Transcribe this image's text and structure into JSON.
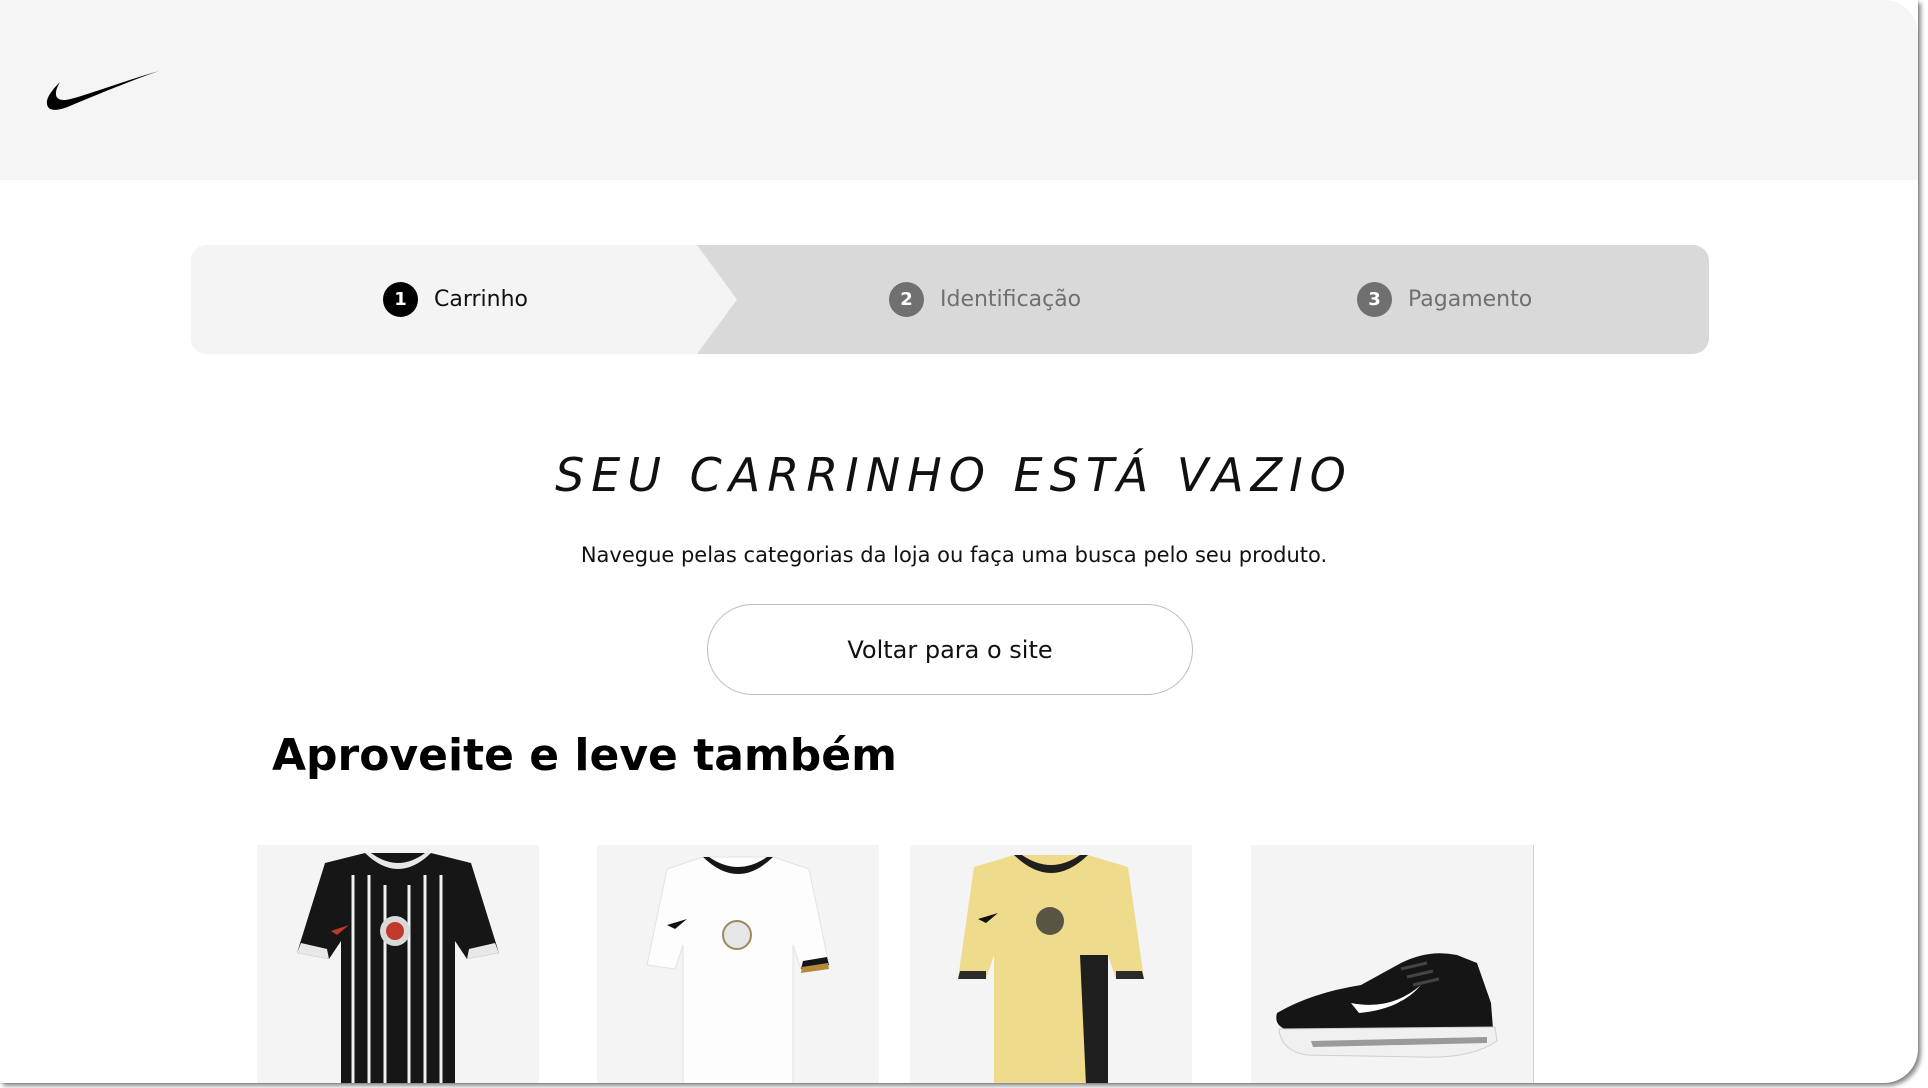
{
  "brand": {
    "logo_icon": "nike-swoosh-icon"
  },
  "steps": [
    {
      "number": "1",
      "label": "Carrinho",
      "active": true
    },
    {
      "number": "2",
      "label": "Identificação",
      "active": false
    },
    {
      "number": "3",
      "label": "Pagamento",
      "active": false
    }
  ],
  "cart": {
    "empty_title": "SEU CARRINHO ESTÁ VAZIO",
    "empty_subtitle": "Navegue pelas categorias da loja ou faça uma busca pelo seu produto.",
    "back_button_label": "Voltar para o site"
  },
  "recommendations": {
    "title": "Aproveite e leve também",
    "products": [
      {
        "image": "black-striped-jersey"
      },
      {
        "image": "white-jersey"
      },
      {
        "image": "yellow-jersey"
      },
      {
        "image": "black-running-shoe"
      }
    ]
  },
  "colors": {
    "header_bg": "#f5f5f5",
    "stepper_bg": "#d9d9d9",
    "active_step_bg": "#f4f4f4",
    "active_step_number": "#000000",
    "inactive_step": "#707070",
    "jersey_yellow": "#eedc8c"
  }
}
